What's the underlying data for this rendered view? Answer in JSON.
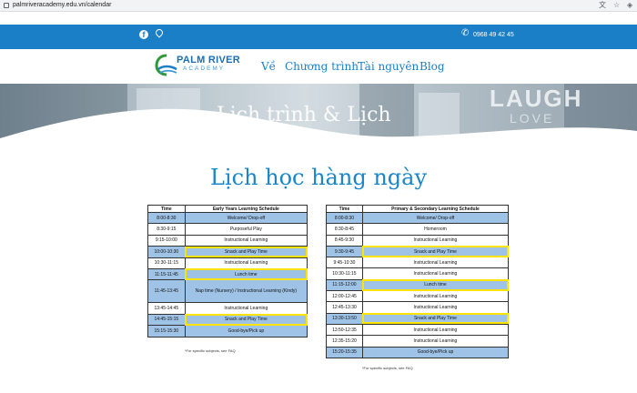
{
  "browser": {
    "url": "palmriveracademy.edu.vn/calendar"
  },
  "topbar": {
    "phone": "0968 49 42 45"
  },
  "header": {
    "logo_line1": "PALM RIVER",
    "logo_line2": "ACADEMY",
    "nav": [
      "Về",
      "Chương trình",
      "Tài nguyên",
      "Blog"
    ]
  },
  "hero": {
    "title": "Lịch trình & Lịch",
    "sign_text": "LAUGH",
    "sign_text2": "LOVE"
  },
  "page_title": "Lịch học hàng ngày",
  "early_years": {
    "headers": [
      "Time",
      "Early Years Learning Schedule"
    ],
    "rows": [
      {
        "time": "8:00-8:30",
        "activity": "Welcome/ Drop-off",
        "highlight": true,
        "yellow": false
      },
      {
        "time": "8:30-9:15",
        "activity": "Purposeful Play",
        "highlight": false,
        "yellow": false
      },
      {
        "time": "9:15-10:00",
        "activity": "Instructional Learning",
        "highlight": false,
        "yellow": false
      },
      {
        "time": "10:00-10:30",
        "activity": "Snack and Play Time",
        "highlight": true,
        "yellow": true
      },
      {
        "time": "10:30-11:15",
        "activity": "Instructional Learning",
        "highlight": false,
        "yellow": false
      },
      {
        "time": "11:15-11:45",
        "activity": "Lunch time",
        "highlight": true,
        "yellow": true
      },
      {
        "time": "11:45-13:45",
        "activity": "Nap time (Nursery) / Instructional Learning (Kindy)",
        "highlight": true,
        "yellow": false,
        "tall": true
      },
      {
        "time": "13:45-14:45",
        "activity": "Instructional Learning",
        "highlight": false,
        "yellow": false
      },
      {
        "time": "14:45-15:15",
        "activity": "Snack and Play Time",
        "highlight": true,
        "yellow": true
      },
      {
        "time": "15:15-15:30",
        "activity": "Good-bye/Pick up",
        "highlight": true,
        "yellow": false
      }
    ],
    "note": "*For specific subjects, see FAQ"
  },
  "primary": {
    "headers": [
      "Time",
      "Primary & Secondary Learning Schedule"
    ],
    "rows": [
      {
        "time": "8:00-8:30",
        "activity": "Welcome/ Drop-off",
        "highlight": true,
        "yellow": false
      },
      {
        "time": "8:30-8:45",
        "activity": "Homeroom",
        "highlight": false,
        "yellow": false
      },
      {
        "time": "8:45-9:30",
        "activity": "Instructional Learning",
        "highlight": false,
        "yellow": false
      },
      {
        "time": "9:30-9:45",
        "activity": "Snack and Play Time",
        "highlight": true,
        "yellow": true
      },
      {
        "time": "9:45-10:30",
        "activity": "Instructional Learning",
        "highlight": false,
        "yellow": false
      },
      {
        "time": "10:30-11:15",
        "activity": "Instructional Learning",
        "highlight": false,
        "yellow": false
      },
      {
        "time": "11:15-12:00",
        "activity": "Lunch time",
        "highlight": true,
        "yellow": true
      },
      {
        "time": "12:00-12:45",
        "activity": "Instructional Learning",
        "highlight": false,
        "yellow": false
      },
      {
        "time": "12:45-13:30",
        "activity": "Instructional Learning",
        "highlight": false,
        "yellow": false
      },
      {
        "time": "13:30-13:50",
        "activity": "Snack and Play Time",
        "highlight": true,
        "yellow": true
      },
      {
        "time": "13:50-12:35",
        "activity": "Instructional Learning",
        "highlight": false,
        "yellow": false
      },
      {
        "time": "12:35-15:20",
        "activity": "Instructional Learning",
        "highlight": false,
        "yellow": false
      },
      {
        "time": "15:20-15:35",
        "activity": "Good-bye/Pick up",
        "highlight": true,
        "yellow": false
      }
    ],
    "note": "*For specific subjects, see FAQ"
  },
  "colors": {
    "brand_blue": "#1a7fc6",
    "row_highlight": "#9fc3e7",
    "outline_yellow": "#ffe400"
  }
}
